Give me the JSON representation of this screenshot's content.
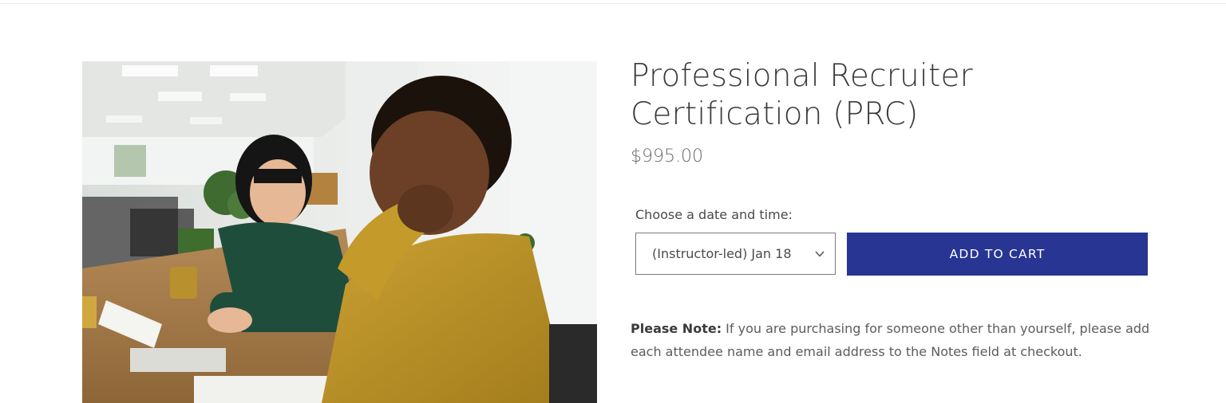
{
  "product": {
    "title": "Professional Recruiter Certification (PRC)",
    "price": "$995.00",
    "image_alt": "Two colleagues talking at a table in an office",
    "variant": {
      "label": "Choose a date and time:",
      "selected": "(Instructor-led) Jan 18"
    },
    "add_to_cart_label": "ADD TO CART",
    "note": {
      "label": "Please Note:",
      "text": " If you are purchasing for someone other than yourself, please add each attendee name and email address to the Notes field at checkout."
    }
  },
  "colors": {
    "button_bg": "#283593",
    "button_text": "#ffffff",
    "heading": "#3a3a3a",
    "body_text": "#5c5c5c"
  },
  "icons": {
    "select_chevron": "chevron-down-icon"
  }
}
